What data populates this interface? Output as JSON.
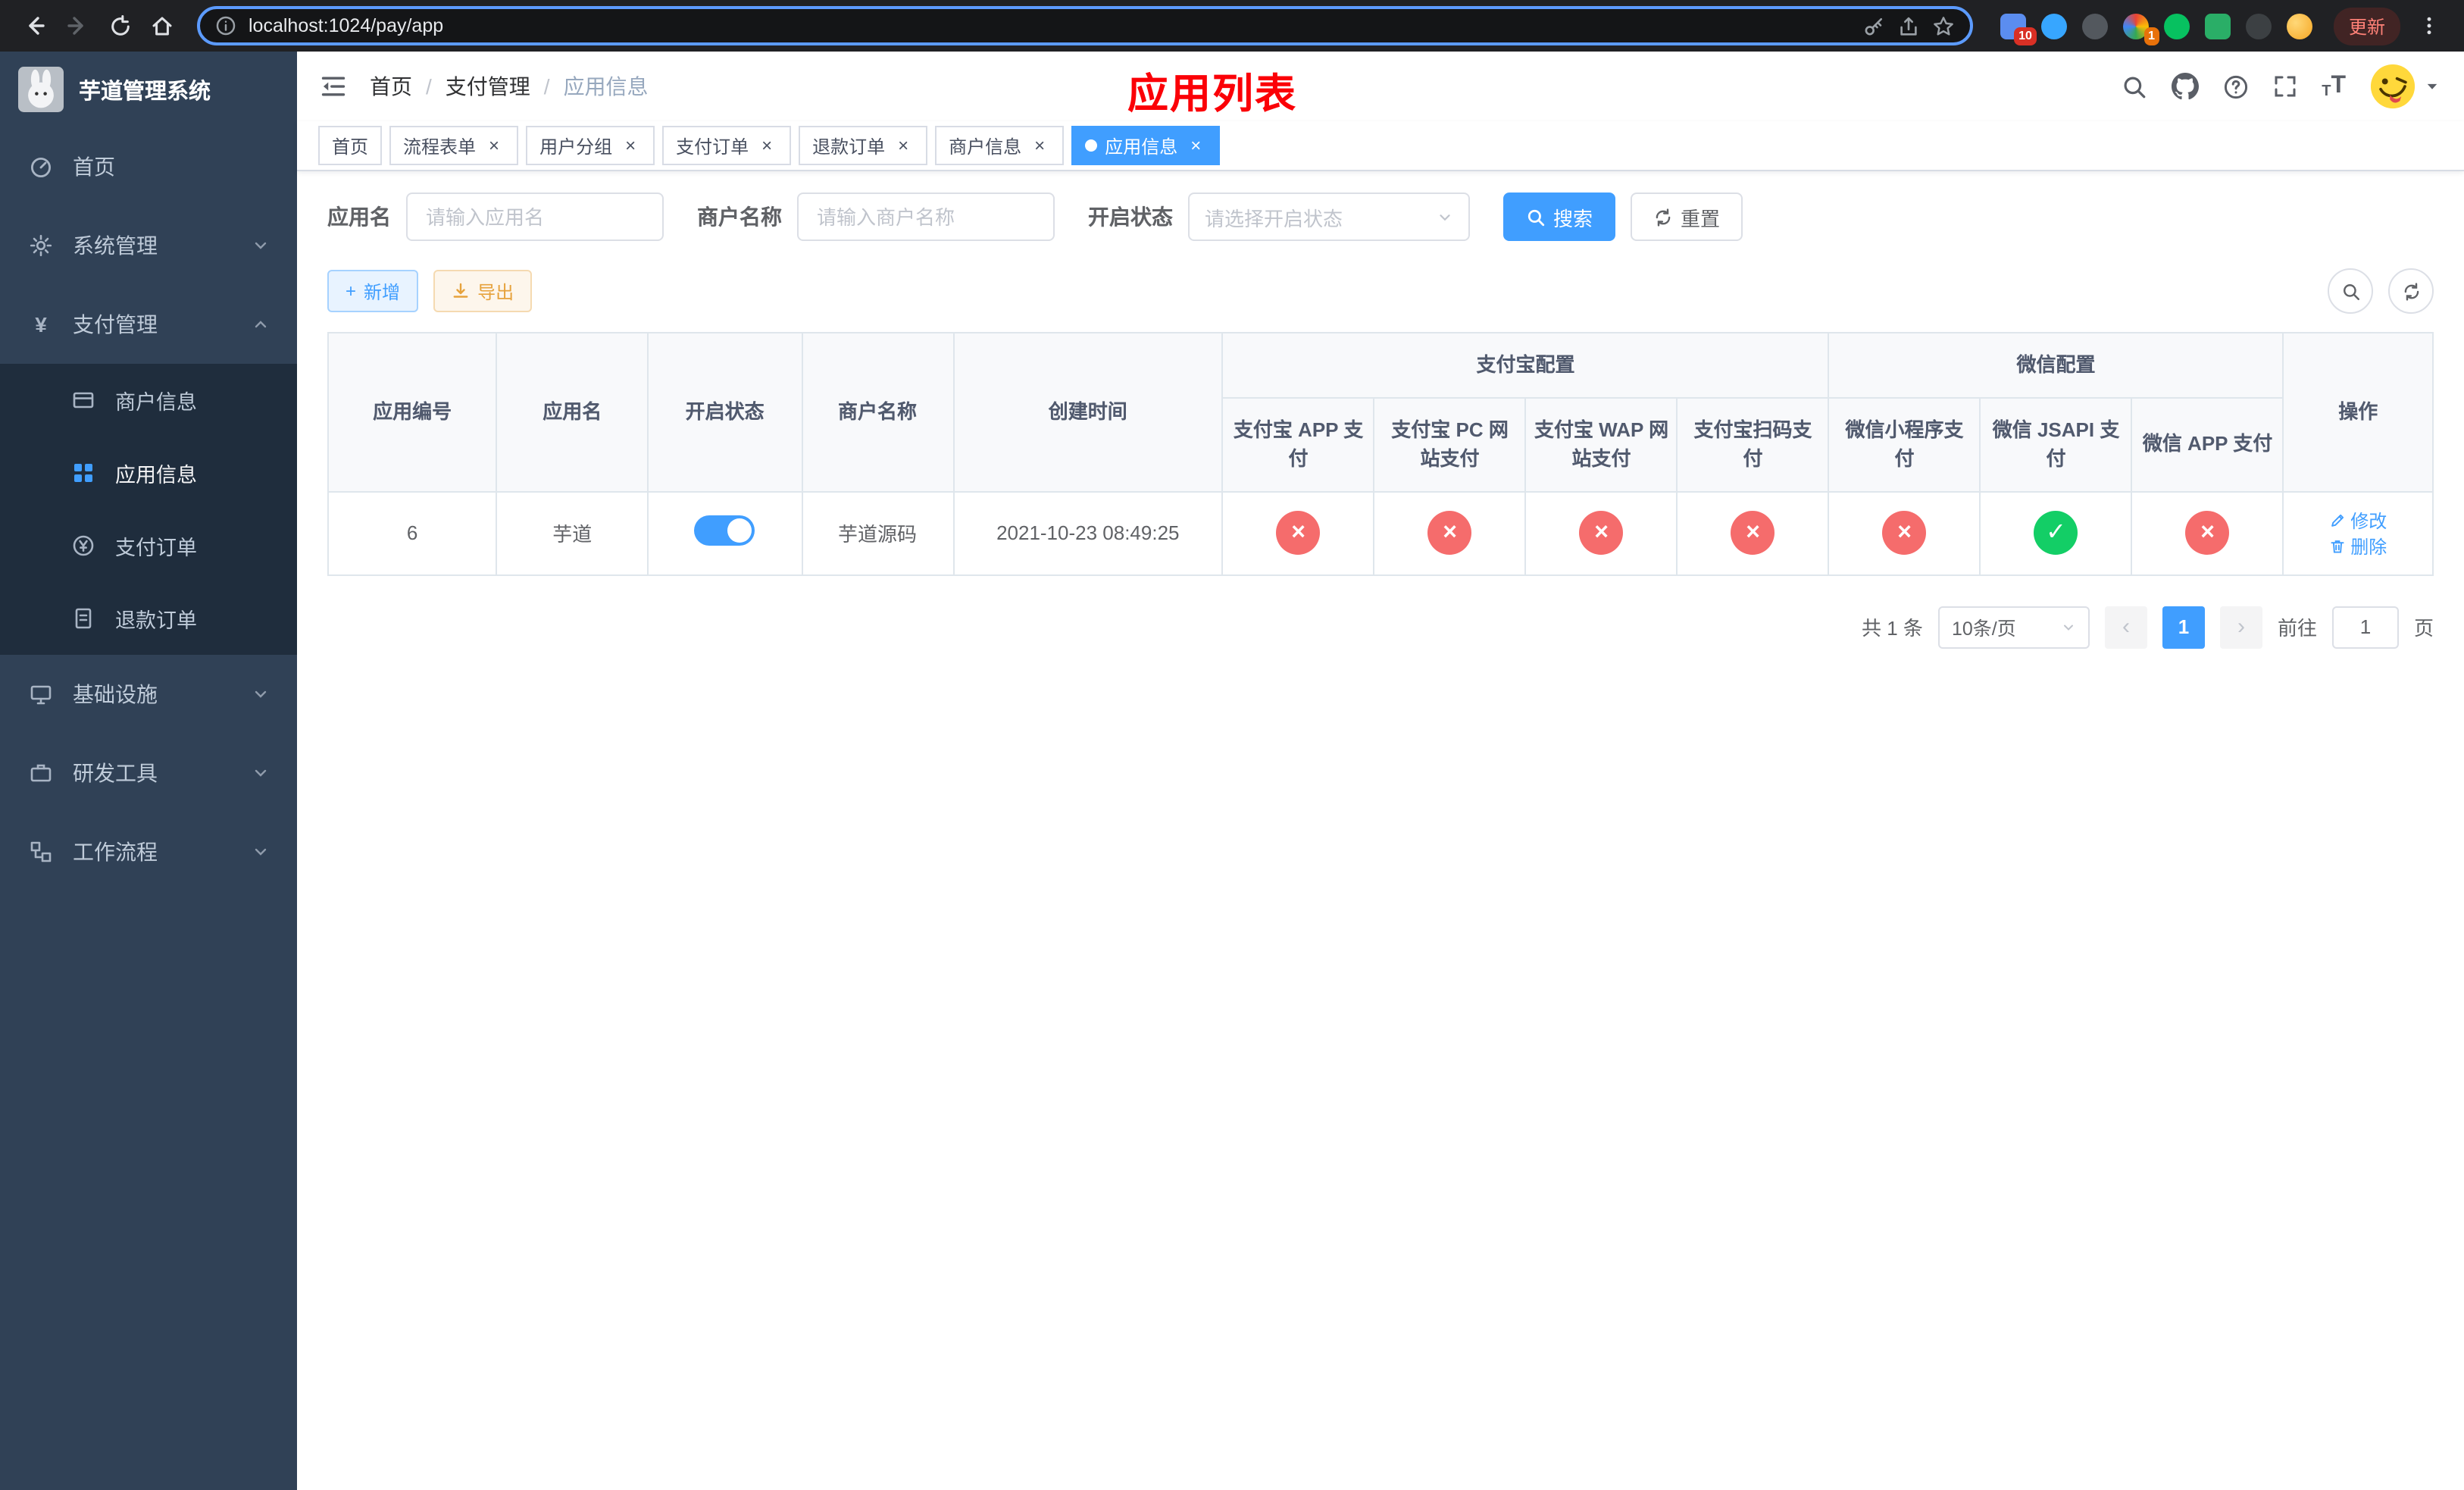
{
  "browser": {
    "url": "localhost:1024/pay/app",
    "update_label": "更新",
    "extension_badge_10": "10",
    "extension_badge_1": "1"
  },
  "app": {
    "title": "芋道管理系统"
  },
  "sidebar": {
    "items": [
      {
        "label": "首页"
      },
      {
        "label": "系统管理"
      },
      {
        "label": "支付管理",
        "children": [
          {
            "label": "商户信息"
          },
          {
            "label": "应用信息"
          },
          {
            "label": "支付订单"
          },
          {
            "label": "退款订单"
          }
        ]
      },
      {
        "label": "基础设施"
      },
      {
        "label": "研发工具"
      },
      {
        "label": "工作流程"
      }
    ]
  },
  "header": {
    "breadcrumb": [
      "首页",
      "支付管理",
      "应用信息"
    ],
    "annotation": "应用列表"
  },
  "tabs": [
    {
      "label": "首页"
    },
    {
      "label": "流程表单"
    },
    {
      "label": "用户分组"
    },
    {
      "label": "支付订单"
    },
    {
      "label": "退款订单"
    },
    {
      "label": "商户信息"
    },
    {
      "label": "应用信息"
    }
  ],
  "filters": {
    "app_name_label": "应用名",
    "app_name_placeholder": "请输入应用名",
    "merchant_label": "商户名称",
    "merchant_placeholder": "请输入商户名称",
    "status_label": "开启状态",
    "status_placeholder": "请选择开启状态",
    "search_label": "搜索",
    "reset_label": "重置"
  },
  "toolbar": {
    "add_label": "新增",
    "export_label": "导出"
  },
  "table": {
    "columns": [
      "应用编号",
      "应用名",
      "开启状态",
      "商户名称",
      "创建时间"
    ],
    "groups": [
      "支付宝配置",
      "微信配置"
    ],
    "sub_columns": [
      "支付宝 APP 支付",
      "支付宝 PC 网站支付",
      "支付宝 WAP 网站支付",
      "支付宝扫码支付",
      "微信小程序支付",
      "微信 JSAPI 支付",
      "微信 APP 支付"
    ],
    "actions_header": "操作",
    "rows": [
      {
        "id": "6",
        "name": "芋道",
        "enabled": true,
        "merchant": "芋道源码",
        "created_at": "2021-10-23 08:49:25",
        "channel_status": [
          "disabled",
          "disabled",
          "disabled",
          "disabled",
          "disabled",
          "enabled",
          "disabled"
        ],
        "edit_label": "修改",
        "delete_label": "删除"
      }
    ]
  },
  "pagination": {
    "total_text": "共 1 条",
    "page_size_text": "10条/页",
    "current_page": "1",
    "goto_label": "前往",
    "goto_value": "1",
    "page_unit_label": "页"
  },
  "icons": {
    "yen": "¥",
    "check": "✓",
    "cross": "×",
    "plus": "+",
    "close": "×",
    "separator": "/",
    "prev": "‹",
    "next": "›",
    "font_size": "T"
  },
  "colors": {
    "accent": "#409eff",
    "danger": "#f56c6c",
    "success": "#13ce66",
    "warning": "#e6a23c",
    "annotation": "#fb0007"
  }
}
